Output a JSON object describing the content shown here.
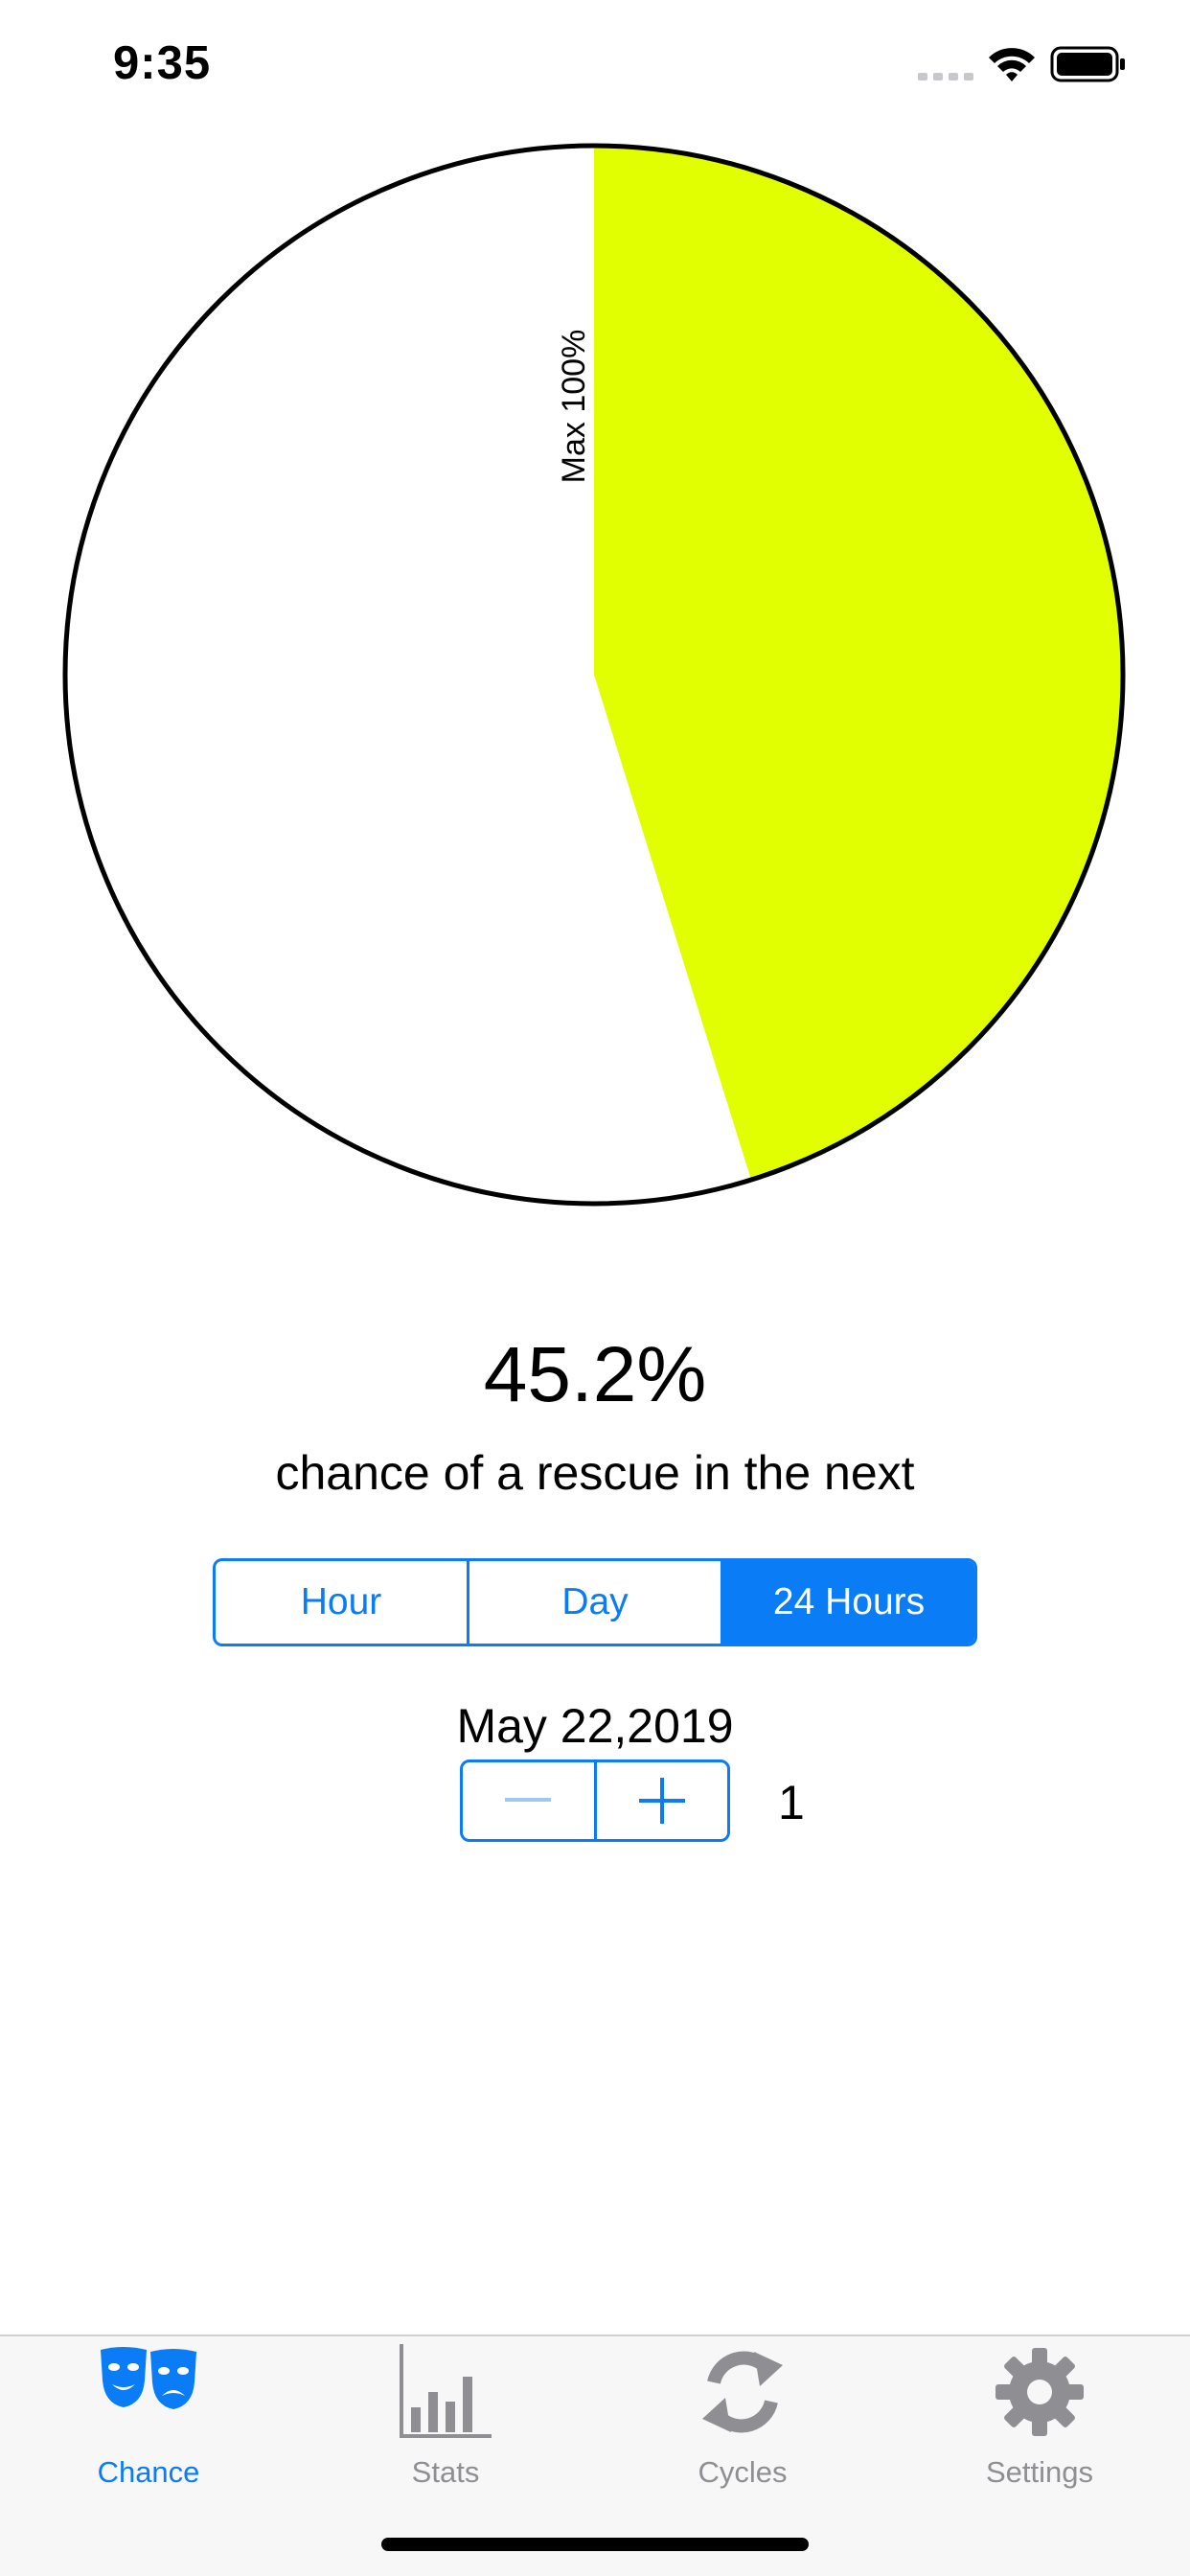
{
  "status_bar": {
    "time": "9:35"
  },
  "pie": {
    "label": "Max 100%",
    "fraction": 0.452,
    "fill_color": "#e2ff00",
    "background_color": "#ffffff",
    "outline_color": "#000000"
  },
  "result": {
    "percent": "45.2%",
    "caption": "chance of a rescue in the next"
  },
  "period_selector": {
    "segments": [
      "Hour",
      "Day",
      "24 Hours"
    ],
    "selected": "24 Hours"
  },
  "date": "May 22,2019",
  "stepper": {
    "value": "1",
    "minus_enabled": false
  },
  "tab_bar": {
    "active": "Chance",
    "tabs": [
      {
        "label": "Chance",
        "icon": "theater-masks-icon"
      },
      {
        "label": "Stats",
        "icon": "bar-chart-icon"
      },
      {
        "label": "Cycles",
        "icon": "cycle-arrows-icon"
      },
      {
        "label": "Settings",
        "icon": "gear-icon"
      }
    ]
  },
  "colors": {
    "accent": "#0a7cf5",
    "inactive": "#8e8e93",
    "disabled": "#9cc7f7"
  }
}
